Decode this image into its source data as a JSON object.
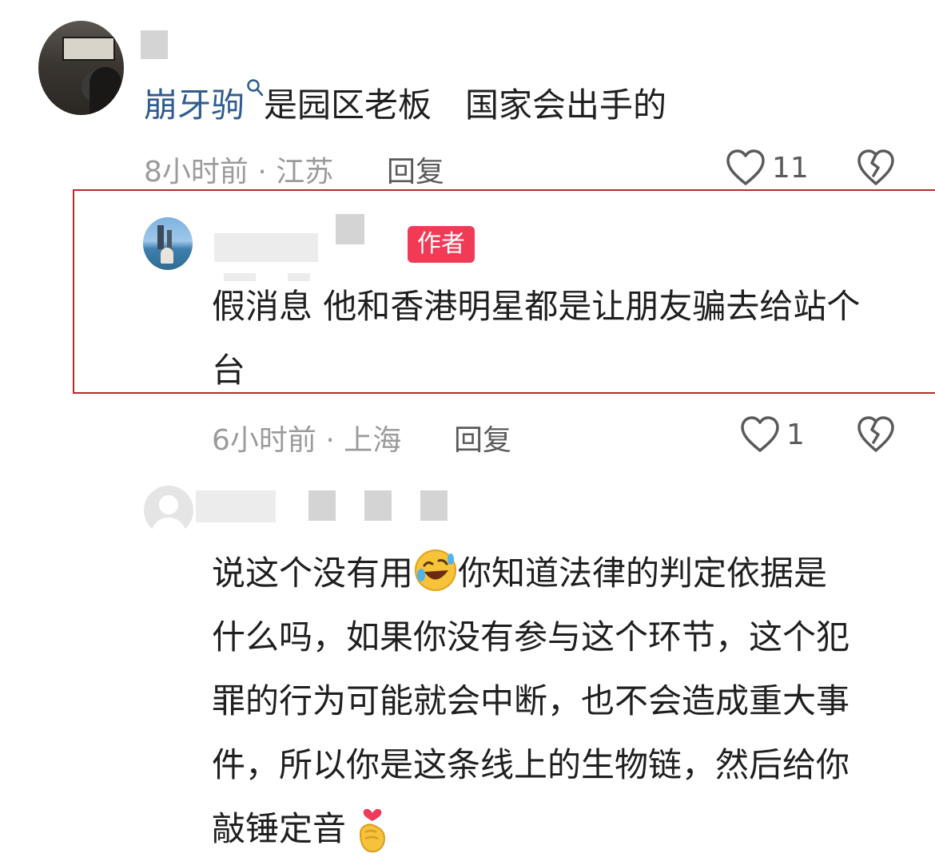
{
  "comments": [
    {
      "mention": "崩牙驹",
      "text": "是园区老板　国家会出手的",
      "time": "8小时前",
      "location": "江苏",
      "reply_label": "回复",
      "likes": "11"
    },
    {
      "author_badge": "作者",
      "text_line1": "假消息 他和香港明星都是让朋友骗去给站个",
      "text_line2": "台",
      "time": "6小时前",
      "location": "上海",
      "reply_label": "回复",
      "likes": "1"
    },
    {
      "lines": [
        "说这个没有用",
        "你知道法律的判定依据是",
        "什么吗，如果你没有参与这个环节，这个犯",
        "罪的行为可能就会中断，也不会造成重大事",
        "件，所以你是这条线上的生物链，然后给你",
        "敲锤定音"
      ]
    }
  ],
  "meta_separator": "·",
  "icons": {
    "mention_search": "search-icon",
    "like": "heart-outline-icon",
    "dislike": "broken-heart-icon",
    "emoji_laugh": "rofl-emoji-icon",
    "emoji_heart_hand": "finger-heart-emoji-icon"
  },
  "colors": {
    "mention": "#2f5b8e",
    "badge": "#f03a56",
    "highlight_border": "#b62a2a"
  }
}
